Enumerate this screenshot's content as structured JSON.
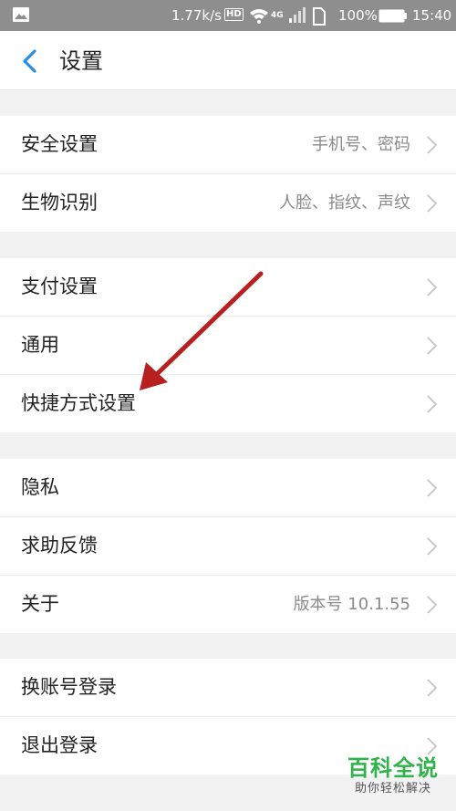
{
  "status_bar": {
    "speed": "1.77k/s",
    "hd": "HD",
    "network": "4G",
    "battery": "100%",
    "time": "15:40",
    "icons": [
      "image-icon",
      "hd-icon",
      "wifi-icon",
      "signal-icon",
      "sim-icon",
      "battery-icon"
    ]
  },
  "header": {
    "title": "设置",
    "back_icon": "chevron-left-icon",
    "accent_color": "#2a8de8"
  },
  "groups": [
    [
      {
        "label": "安全设置",
        "value": "手机号、密码"
      },
      {
        "label": "生物识别",
        "value": "人脸、指纹、声纹"
      }
    ],
    [
      {
        "label": "支付设置",
        "value": ""
      },
      {
        "label": "通用",
        "value": ""
      },
      {
        "label": "快捷方式设置",
        "value": ""
      }
    ],
    [
      {
        "label": "隐私",
        "value": ""
      },
      {
        "label": "求助反馈",
        "value": ""
      },
      {
        "label": "关于",
        "value": "版本号 10.1.55"
      }
    ],
    [
      {
        "label": "换账号登录",
        "value": ""
      },
      {
        "label": "退出登录",
        "value": ""
      }
    ]
  ],
  "annotation": {
    "color": "#b81f1f",
    "icon": "red-arrow-icon"
  },
  "watermark": {
    "title": "百科全说",
    "subtitle": "助你轻松解决",
    "color": "#2fb34a"
  }
}
